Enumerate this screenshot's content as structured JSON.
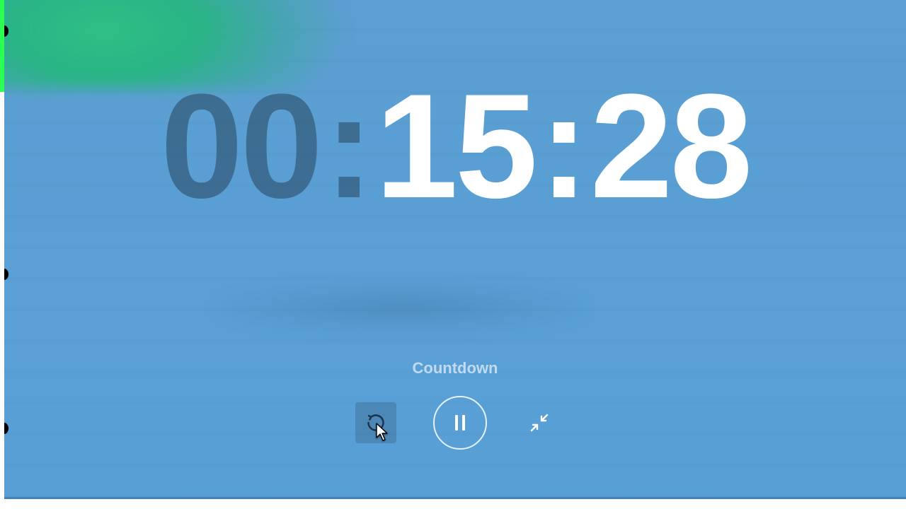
{
  "timer": {
    "hours": "00",
    "minutes": "15",
    "seconds": "28",
    "sep": ":",
    "label": "Countdown"
  },
  "controls": {
    "reset_name": "reset-button",
    "pause_name": "pause-button",
    "collapse_name": "exit-fullscreen-button"
  },
  "colors": {
    "background": "#5a9fd3",
    "accent_green": "#2fbf84",
    "dim_text": "rgba(39,68,93,0.55)",
    "bright_text": "#ffffff"
  }
}
